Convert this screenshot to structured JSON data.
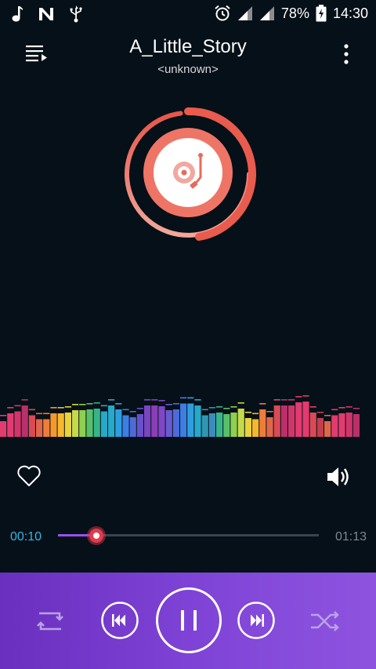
{
  "status_bar": {
    "battery": "78%",
    "time": "14:30",
    "left_icons": [
      "music-note-icon",
      "n-icon",
      "usb-icon"
    ],
    "right_icons": [
      "alarm-icon",
      "signal-icon",
      "signal-icon",
      "battery-icon"
    ]
  },
  "header": {
    "title": "A_Little_Story",
    "subtitle": "<unknown>"
  },
  "player": {
    "current_time": "00:10",
    "total_time": "01:13",
    "progress_fraction": 0.14,
    "liked": false,
    "state": "playing"
  },
  "visualizer": {
    "bar_levels": [
      0.4,
      0.6,
      0.65,
      0.8,
      0.55,
      0.45,
      0.45,
      0.6,
      0.6,
      0.62,
      0.68,
      0.68,
      0.7,
      0.72,
      0.65,
      0.8,
      0.7,
      0.55,
      0.5,
      0.58,
      0.8,
      0.8,
      0.78,
      0.68,
      0.7,
      0.85,
      0.85,
      0.8,
      0.55,
      0.6,
      0.62,
      0.58,
      0.62,
      0.72,
      0.48,
      0.45,
      0.7,
      0.5,
      0.8,
      0.8,
      0.8,
      0.88,
      0.9,
      0.62,
      0.48,
      0.4,
      0.55,
      0.6,
      0.62,
      0.58
    ],
    "colors": [
      "#e23b6f",
      "#e23b6f",
      "#d2356a",
      "#b9306a",
      "#d94a55",
      "#e0664a",
      "#f07c3a",
      "#f29a2c",
      "#f6b72d",
      "#e9d33a",
      "#c6d94a",
      "#8ed04f",
      "#58c06a",
      "#37b58a",
      "#27a9c9",
      "#27a9c9",
      "#2e9ee0",
      "#3b7fe3",
      "#4f6ad8",
      "#6750c8",
      "#7a45c0",
      "#8a3eb8",
      "#7e47c6",
      "#6a5ad0",
      "#4d6bd8",
      "#3b7fe3",
      "#2e9ee0",
      "#27a9c9",
      "#2f97b4",
      "#3a8cc0",
      "#37b58a",
      "#58c06a",
      "#8ed04f",
      "#c6d94a",
      "#e9d33a",
      "#f6b72d",
      "#f07c3a",
      "#e0664a",
      "#d94a55",
      "#b9306a",
      "#d2356a",
      "#e23b6f",
      "#e23b6f",
      "#d94a55",
      "#c33e4e",
      "#e0664a",
      "#e23b6f",
      "#e23b6f",
      "#d2356a",
      "#b9306a"
    ]
  },
  "controls": {
    "repeat_icon": "repeat-icon",
    "prev_icon": "skip-previous-icon",
    "pause_icon": "pause-icon",
    "next_icon": "skip-next-icon",
    "shuffle_icon": "shuffle-icon"
  }
}
